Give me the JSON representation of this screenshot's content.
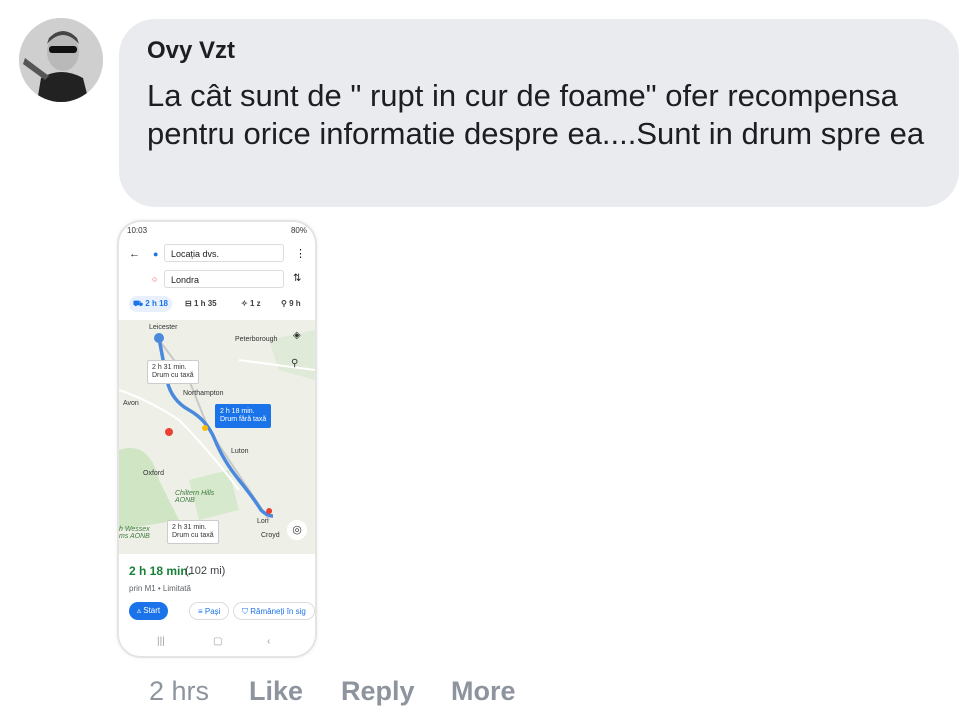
{
  "comment": {
    "author": "Ovy Vzt",
    "text": "La cât sunt de \" rupt in cur de foame\" ofer recompensa pentru orice informatie despre ea....Sunt in drum spre ea",
    "time": "2 hrs",
    "actions": {
      "like": "Like",
      "reply": "Reply",
      "more": "More"
    }
  },
  "screenshot": {
    "status": {
      "time": "10:03",
      "battery": "80%"
    },
    "origin": "Locația dvs.",
    "destination": "Londra",
    "modes": [
      {
        "label": "2 h 18",
        "icon": "car-icon",
        "active": true
      },
      {
        "label": "1 h 35",
        "icon": "train-icon",
        "active": false
      },
      {
        "label": "1 z",
        "icon": "walk-icon",
        "active": false
      },
      {
        "label": "9 h",
        "icon": "bike-icon",
        "active": false
      }
    ],
    "map_labels": {
      "leicester": "Leicester",
      "peterborough": "Peterborough",
      "northampton": "Northampton",
      "avon": "Avon",
      "luton": "Luton",
      "oxford": "Oxford",
      "chiltern": "Chiltern Hills AONB",
      "wessex": "h Wessex ms AONB",
      "london": "Lon",
      "croydon": "Croyd"
    },
    "callouts": [
      {
        "time": "2 h 31 min.",
        "desc": "Drum cu taxă",
        "selected": false
      },
      {
        "time": "2 h 18 min.",
        "desc": "Drum fără taxă",
        "selected": true
      },
      {
        "time": "2 h 31 min.",
        "desc": "Drum cu taxă",
        "selected": false
      }
    ],
    "summary": {
      "eta": "2 h 18 min.",
      "distance": "(102 mi)",
      "via": "prin M1 • Limitată",
      "start": "Start",
      "steps": "Pași",
      "safe": "Rămâneți în sig"
    },
    "route_color": "#4a89dc",
    "accent": "#1a73e8",
    "eta_color": "#188038"
  }
}
